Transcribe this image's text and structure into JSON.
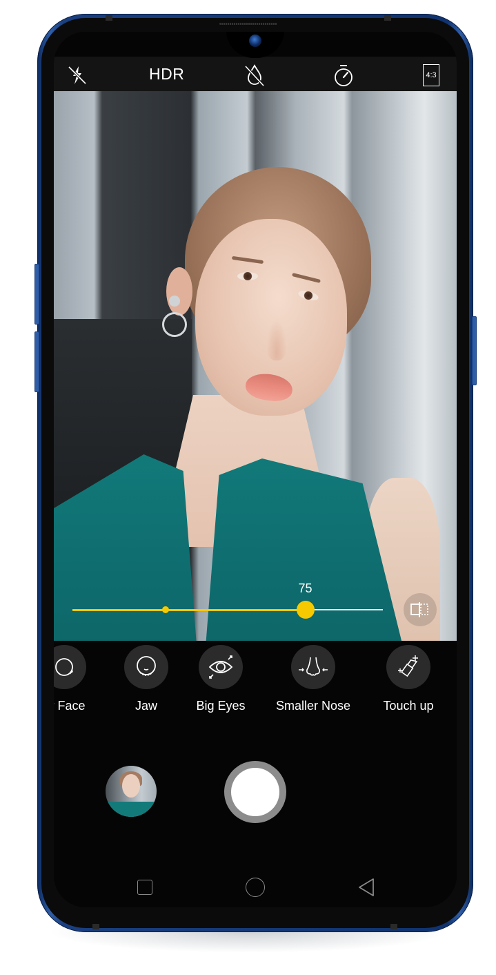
{
  "device": {
    "frame_color": "#1a3f80"
  },
  "camera_topbar": {
    "flash": {
      "icon": "flash-off-icon",
      "state": "off"
    },
    "hdr": {
      "label": "HDR"
    },
    "filter": {
      "icon": "drop-off-icon",
      "state": "off"
    },
    "timer": {
      "icon": "timer-icon"
    },
    "aspect_ratio": {
      "label": "4:3"
    }
  },
  "beauty_slider": {
    "value_label": "75",
    "value": 75,
    "max": 100,
    "default_marker": 0.3,
    "accent_color": "#f7c900"
  },
  "compare_button": {
    "icon": "compare-icon"
  },
  "beauty_modes": [
    {
      "label": "er Face",
      "icon": "slimmer-face-icon"
    },
    {
      "label": "Jaw",
      "icon": "jaw-icon"
    },
    {
      "label": "Big Eyes",
      "icon": "big-eyes-icon"
    },
    {
      "label": "Smaller Nose",
      "icon": "smaller-nose-icon"
    },
    {
      "label": "Touch up",
      "icon": "touch-up-icon"
    }
  ],
  "capture": {
    "gallery_thumbnail": "last-photo-thumbnail",
    "shutter": "shutter-button"
  },
  "navigation_bar": [
    {
      "name": "recent-apps",
      "icon": "square-icon"
    },
    {
      "name": "home",
      "icon": "circle-icon"
    },
    {
      "name": "back",
      "icon": "triangle-back-icon"
    }
  ]
}
